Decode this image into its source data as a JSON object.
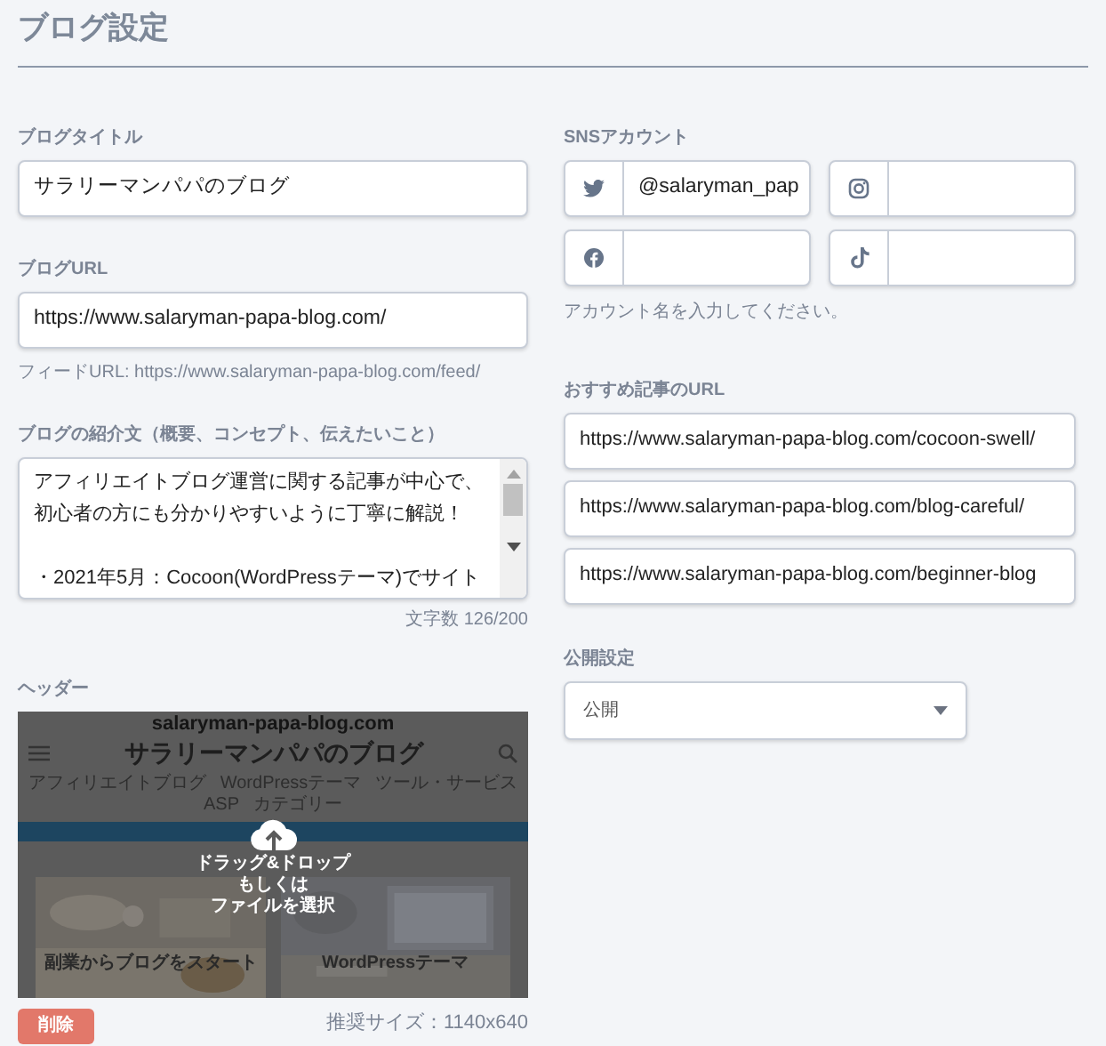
{
  "page_title": "ブログ設定",
  "blog_title": {
    "label": "ブログタイトル",
    "value": "サラリーマンパパのブログ"
  },
  "blog_url": {
    "label": "ブログURL",
    "value": "https://www.salaryman-papa-blog.com/",
    "feed_note": "フィードURL: https://www.salaryman-papa-blog.com/feed/"
  },
  "description": {
    "label": "ブログの紹介文（概要、コンセプト、伝えたいこと）",
    "paragraphs": [
      [
        "アフィリエイトブログ運営に関する記事が中心で、",
        "初心者の方にも分かりやすいように丁寧に解説！"
      ],
      [
        "・2021年5月：Cocoon(WordPressテーマ)でサイト"
      ]
    ],
    "char_count": "文字数 126/200"
  },
  "header": {
    "label": "ヘッダー",
    "preview": {
      "domain": "salaryman-papa-blog.com",
      "site_title": "サラリーマンパパのブログ",
      "nav": [
        "アフィリエイトブログ",
        "WordPressテーマ",
        "ツール・サービス",
        "ASP",
        "カテゴリー"
      ],
      "cards": [
        "副業からブログをスタート",
        "WordPressテーマ"
      ]
    },
    "upload_lines": [
      "ドラッグ&ドロップ",
      "もしくは",
      "ファイルを選択"
    ],
    "delete_button": "削除",
    "recommended_size": "推奨サイズ：1140x640"
  },
  "sns": {
    "label": "SNSアカウント",
    "accounts": [
      {
        "kind": "twitter",
        "value": "@salaryman_pap"
      },
      {
        "kind": "instagram"
      },
      {
        "kind": "facebook"
      },
      {
        "kind": "tiktok"
      }
    ],
    "hint": "アカウント名を入力してください。"
  },
  "recommended": {
    "label": "おすすめ記事のURL",
    "urls": [
      "https://www.salaryman-papa-blog.com/cocoon-swell/",
      "https://www.salaryman-papa-blog.com/blog-careful/",
      "https://www.salaryman-papa-blog.com/beginner-blog"
    ]
  },
  "visibility": {
    "label": "公開設定",
    "value": "公開"
  }
}
